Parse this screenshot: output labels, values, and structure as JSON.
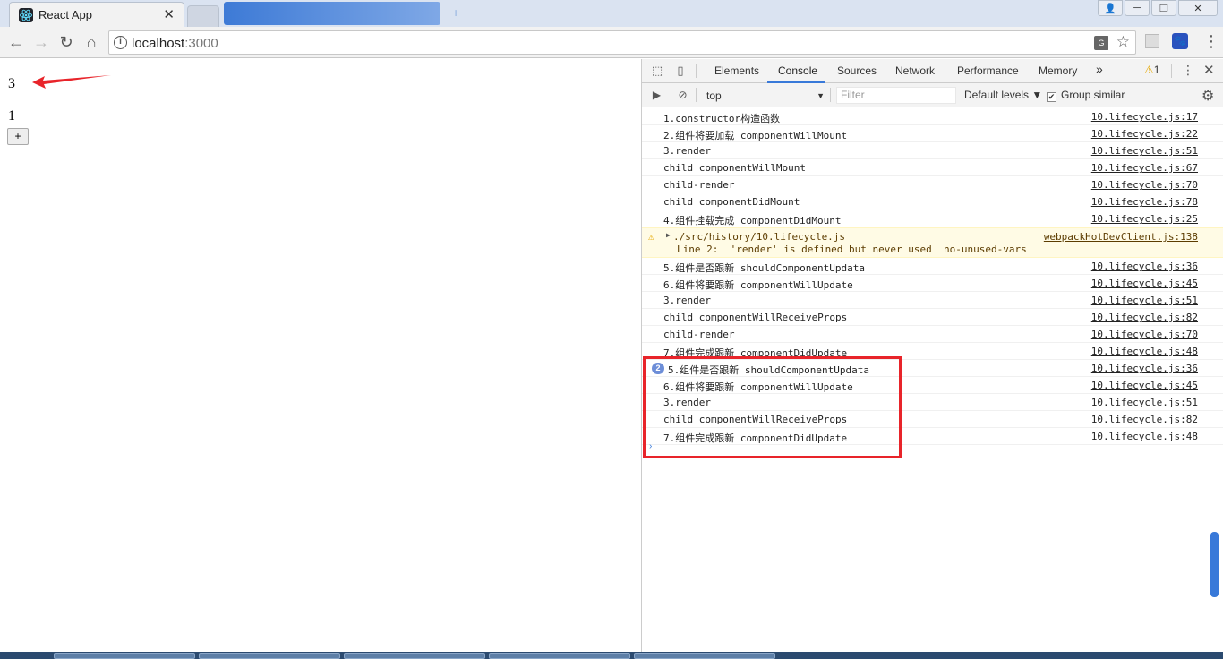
{
  "browser": {
    "tab_title": "React App",
    "tab_close": "✕",
    "url_host": "localhost",
    "url_port": ":3000",
    "window_buttons": [
      "─",
      "❐",
      "✕"
    ]
  },
  "page": {
    "count_value": "3",
    "child_value": "1",
    "increment_label": "+"
  },
  "devtools": {
    "tabs": [
      "Elements",
      "Console",
      "Sources",
      "Network",
      "Performance",
      "Memory"
    ],
    "active_tab": "Console",
    "more_tabs": "»",
    "warning_count": "1",
    "context": "top",
    "filter_placeholder": "Filter",
    "levels": "Default levels ▼",
    "group_similar": "Group similar",
    "console_rows": [
      {
        "msg": "1.constructor构造函数",
        "src": "10.lifecycle.js:17"
      },
      {
        "msg": "2.组件将要加载 componentWillMount",
        "src": "10.lifecycle.js:22"
      },
      {
        "msg": "3.render",
        "src": "10.lifecycle.js:51"
      },
      {
        "msg": "child componentWillMount",
        "src": "10.lifecycle.js:67"
      },
      {
        "msg": "child-render",
        "src": "10.lifecycle.js:70"
      },
      {
        "msg": "child componentDidMount",
        "src": "10.lifecycle.js:78"
      },
      {
        "msg": "4.组件挂载完成 componentDidMount",
        "src": "10.lifecycle.js:25"
      }
    ],
    "warning": {
      "line1": "./src/history/10.lifecycle.js",
      "line2": "Line 2:  'render' is defined but never used  no-unused-vars",
      "src": "webpackHotDevClient.js:138"
    },
    "console_rows_after": [
      {
        "msg": "5.组件是否跟新 shouldComponentUpdata",
        "src": "10.lifecycle.js:36"
      },
      {
        "msg": "6.组件将要跟新 componentWillUpdate",
        "src": "10.lifecycle.js:45"
      },
      {
        "msg": "3.render",
        "src": "10.lifecycle.js:51"
      },
      {
        "msg": "child componentWillReceiveProps",
        "src": "10.lifecycle.js:82"
      },
      {
        "msg": "child-render",
        "src": "10.lifecycle.js:70"
      },
      {
        "msg": "7.组件完成跟新 componentDidUpdate",
        "src": "10.lifecycle.js:48"
      }
    ],
    "console_rows_highlight": [
      {
        "msg": "5.组件是否跟新 shouldComponentUpdata",
        "src": "10.lifecycle.js:36",
        "badge": "2"
      },
      {
        "msg": "6.组件将要跟新 componentWillUpdate",
        "src": "10.lifecycle.js:45"
      },
      {
        "msg": "3.render",
        "src": "10.lifecycle.js:51"
      },
      {
        "msg": "child componentWillReceiveProps",
        "src": "10.lifecycle.js:82"
      },
      {
        "msg": "7.组件完成跟新 componentDidUpdate",
        "src": "10.lifecycle.js:48"
      }
    ]
  },
  "colors": {
    "accent": "#3879d9",
    "highlight_box": "#e8242a",
    "warning_bg": "#fffbe5"
  }
}
